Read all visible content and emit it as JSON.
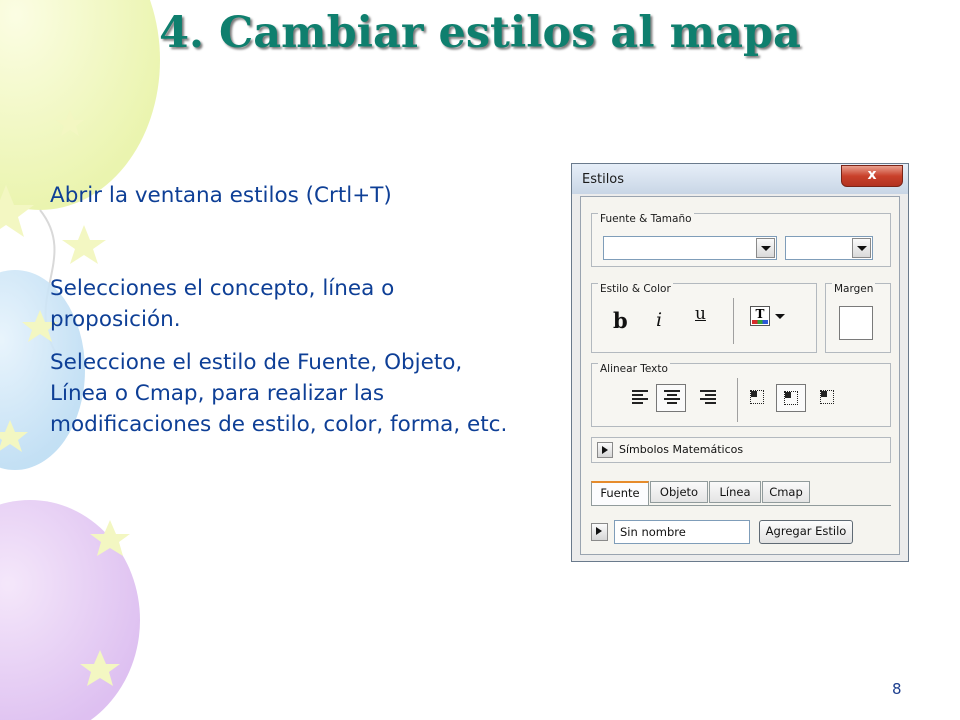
{
  "slide": {
    "title": "4. Cambiar estilos al mapa",
    "bullets": [
      "Abrir la ventana estilos  (Crtl+T)",
      "Selecciones el concepto, línea o proposición.",
      "Seleccione el estilo de Fuente, Objeto, Línea o Cmap, para realizar las modificaciones de estilo, color, forma, etc."
    ],
    "page_number": "8"
  },
  "dialog": {
    "title": "Estilos",
    "close_label": "x",
    "font_group": {
      "label": "Fuente & Tamaño",
      "font_value": "",
      "size_value": ""
    },
    "style_group": {
      "label": "Estilo & Color",
      "bold": "b",
      "italic": "i",
      "underline": "u",
      "color_glyph": "T"
    },
    "margin_group": {
      "label": "Margen"
    },
    "align_group": {
      "label": "Alinear Texto"
    },
    "math_symbols_label": "Símbolos Matemáticos",
    "tabs": [
      "Fuente",
      "Objeto",
      "Línea",
      "Cmap"
    ],
    "active_tab": "Fuente",
    "style_name_value": "Sin nombre",
    "add_style_label": "Agregar Estilo"
  },
  "colors": {
    "title": "#0f7f6e",
    "body_text": "#0e3f96",
    "close_button": "#c9412b",
    "active_tab_accent": "#e68b2c"
  }
}
